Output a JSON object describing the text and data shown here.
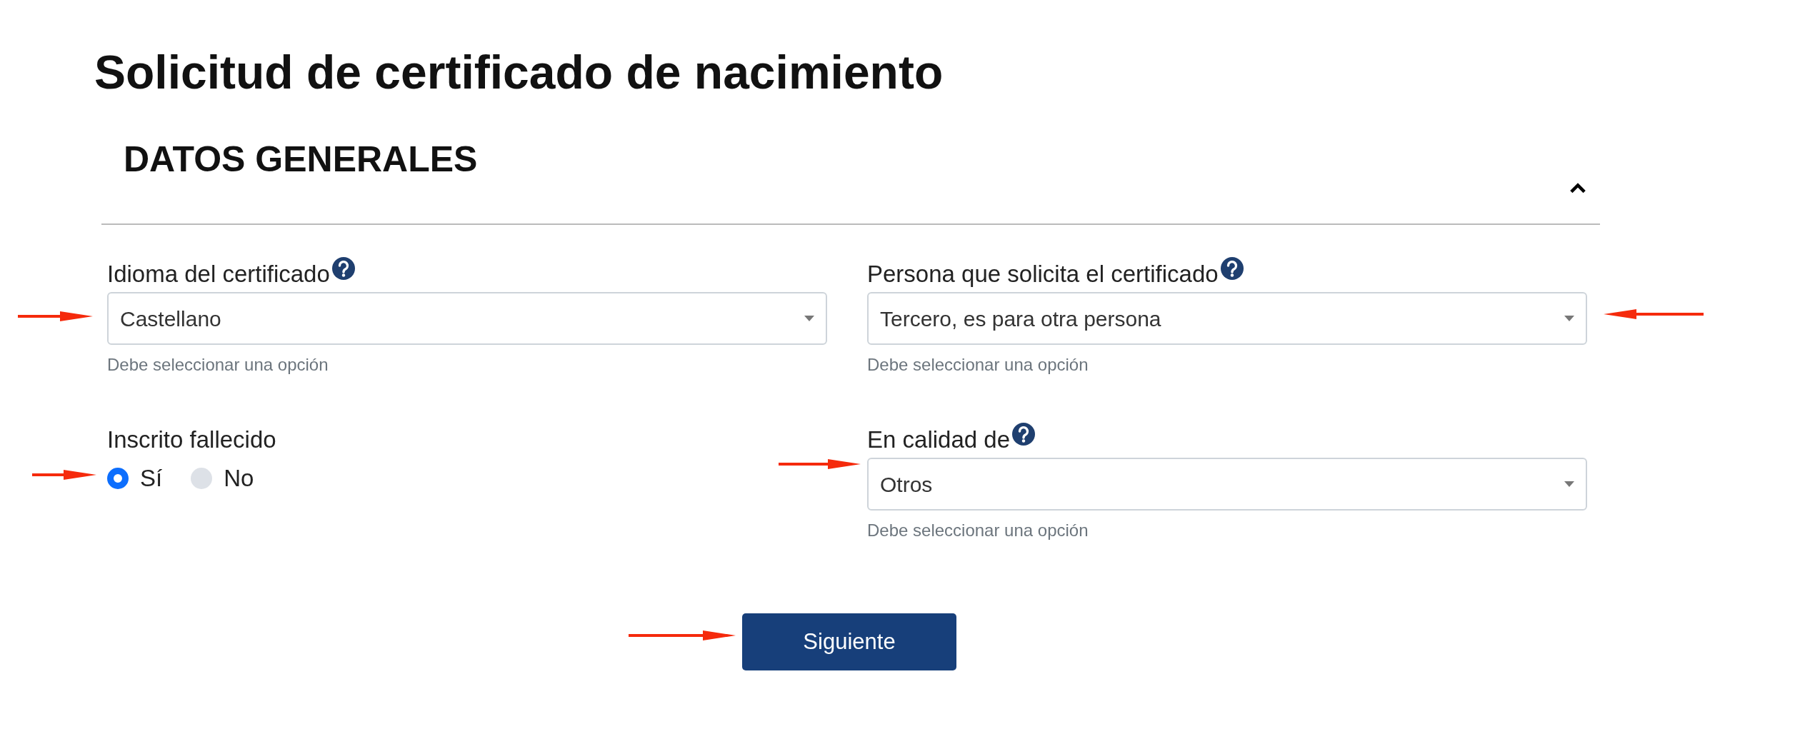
{
  "title": "Solicitud de certificado de nacimiento",
  "section": {
    "title": "DATOS GENERALES",
    "expanded": true
  },
  "fields": [
    {
      "kind": "select",
      "label": "Idioma del certificado",
      "help": true,
      "value": "Castellano",
      "hint": "Debe seleccionar una opción"
    },
    {
      "kind": "select",
      "label": "Persona que solicita el certificado",
      "help": true,
      "value": "Tercero, es para otra persona",
      "hint": "Debe seleccionar una opción"
    },
    {
      "kind": "radio",
      "label": "Inscrito fallecido",
      "help": false,
      "options": [
        {
          "label": "Sí",
          "selected": true
        },
        {
          "label": "No",
          "selected": false
        }
      ]
    },
    {
      "kind": "select",
      "label": "En calidad de",
      "help": true,
      "value": "Otros",
      "hint": "Debe seleccionar una opción"
    }
  ],
  "button": "Siguiente"
}
